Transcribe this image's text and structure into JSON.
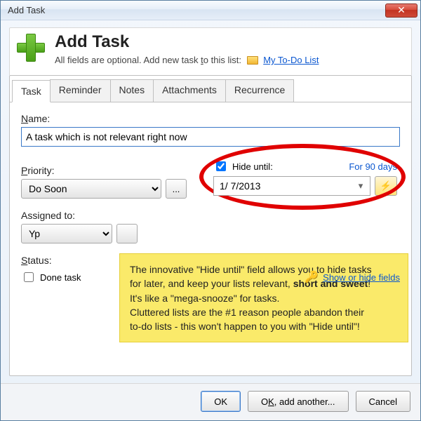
{
  "window": {
    "title": "Add Task",
    "close_glyph": "✕"
  },
  "header": {
    "heading": "Add Task",
    "subtitle_prefix": "All fields are optional. Add new task ",
    "subtitle_to": "t",
    "subtitle_o": "o",
    "subtitle_suffix": " this list:",
    "list_link": "My To-Do List"
  },
  "tabs": {
    "task": "Task",
    "reminder": "Reminder",
    "notes": "Notes",
    "attachments": "Attachments",
    "recurrence": "Recurrence"
  },
  "fields": {
    "name_label_u": "N",
    "name_label_rest": "ame:",
    "name_value": "A task which is not relevant right now",
    "priority_label_u": "P",
    "priority_label_rest": "riority:",
    "priority_value": "Do Soon",
    "more_btn": "...",
    "hide_until_label": "Hide until:",
    "hide_until_u": "H",
    "hide_until_rest": "ide until:",
    "for_days": "For 90 days",
    "date_value": "1/ 7/2013",
    "assigned_label": "Assigned to:",
    "assigned_value": "Yp",
    "status_label_u": "S",
    "status_label_rest": "tatus:",
    "done_label": "Done task",
    "show_hide": "Show or hide fields"
  },
  "note": {
    "line1a": "The innovative \"Hide until\" field allows you to hide tasks",
    "line2a": "for later, and keep your lists relevant, ",
    "line2b": "short and sweet",
    "line2c": "!",
    "line3": "It's like a \"mega-snooze\" for tasks.",
    "line4": "Cluttered lists are the #1 reason people abandon their",
    "line5": "to-do lists - this won't happen to you with \"Hide until\"!"
  },
  "buttons": {
    "ok": "OK",
    "ok_add_pre": "O",
    "ok_add_u": "K",
    "ok_add_post": ", add another...",
    "cancel": "Cancel"
  },
  "icons": {
    "star": "⚡",
    "datepicker": "▾",
    "key": "🔑"
  }
}
